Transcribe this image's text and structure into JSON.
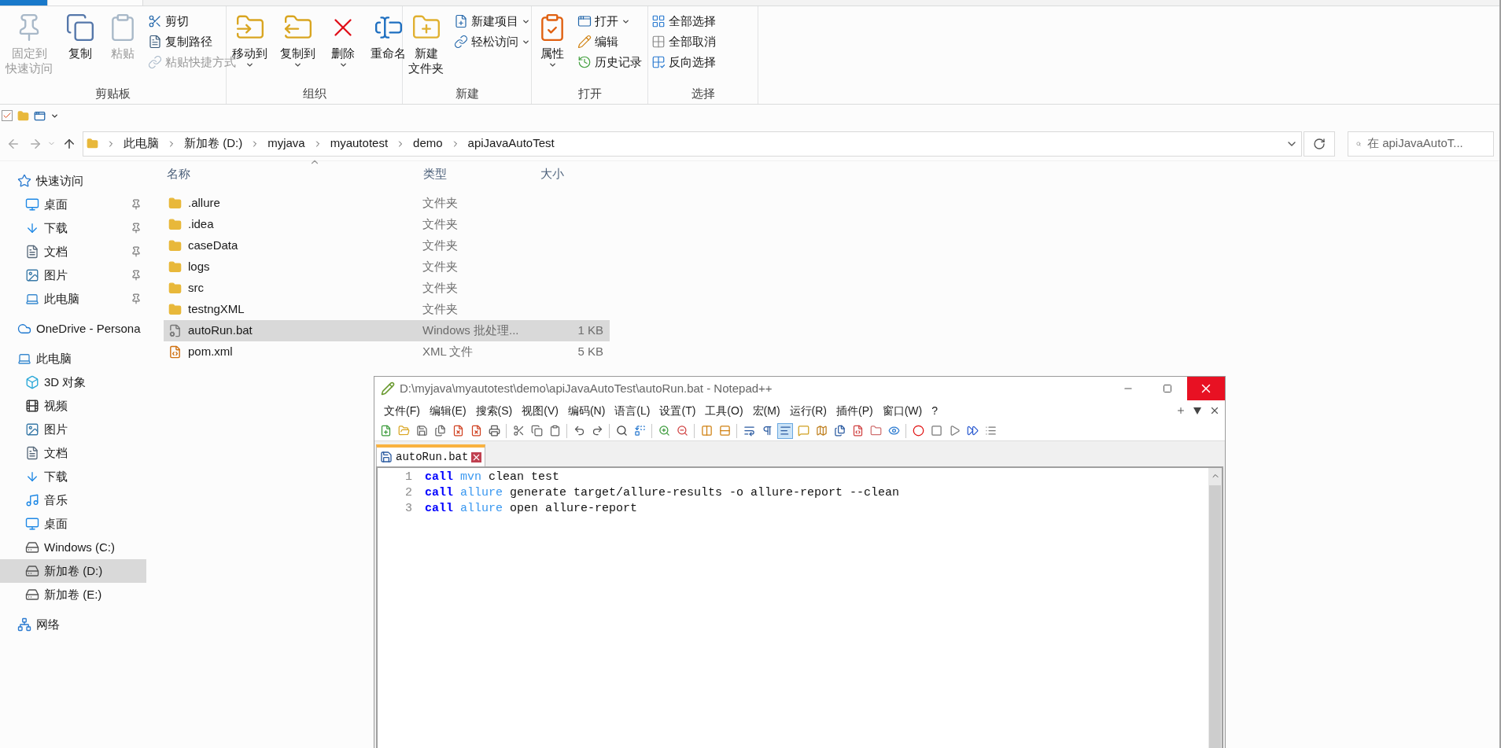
{
  "ribbon": {
    "groups": [
      {
        "label": "剪贴板",
        "items": [
          {
            "kind": "large",
            "label_lines": [
              "固定到",
              "快速访问"
            ],
            "disabled": true,
            "dropdown": false
          },
          {
            "kind": "large",
            "label": "复制",
            "disabled": false,
            "dropdown": false
          },
          {
            "kind": "large",
            "label": "粘贴",
            "disabled": true,
            "dropdown": false
          },
          {
            "kind": "small",
            "label": "剪切",
            "disabled": false,
            "dropdown": false
          },
          {
            "kind": "small",
            "label": "复制路径",
            "disabled": false,
            "dropdown": false
          },
          {
            "kind": "small",
            "label": "粘贴快捷方式",
            "disabled": true,
            "dropdown": false
          }
        ]
      },
      {
        "label": "组织",
        "items": [
          {
            "kind": "large",
            "label": "移动到",
            "disabled": false,
            "dropdown": true
          },
          {
            "kind": "large",
            "label": "复制到",
            "disabled": false,
            "dropdown": true
          },
          {
            "kind": "large",
            "label": "删除",
            "disabled": false,
            "dropdown": true
          },
          {
            "kind": "large",
            "label": "重命名",
            "disabled": false,
            "dropdown": false
          }
        ]
      },
      {
        "label": "新建",
        "items": [
          {
            "kind": "large",
            "label_lines": [
              "新建",
              "文件夹"
            ],
            "disabled": false,
            "dropdown": false
          },
          {
            "kind": "small",
            "label": "新建项目",
            "disabled": false,
            "dropdown": true
          },
          {
            "kind": "small",
            "label": "轻松访问",
            "disabled": false,
            "dropdown": true
          }
        ]
      },
      {
        "label": "打开",
        "items": [
          {
            "kind": "large",
            "label": "属性",
            "disabled": false,
            "dropdown": true
          },
          {
            "kind": "small",
            "label": "打开",
            "disabled": false,
            "dropdown": true
          },
          {
            "kind": "small",
            "label": "编辑",
            "disabled": false,
            "dropdown": false
          },
          {
            "kind": "small",
            "label": "历史记录",
            "disabled": false,
            "dropdown": false
          }
        ]
      },
      {
        "label": "选择",
        "items": [
          {
            "kind": "small",
            "label": "全部选择",
            "disabled": false,
            "dropdown": false
          },
          {
            "kind": "small",
            "label": "全部取消",
            "disabled": false,
            "dropdown": false
          },
          {
            "kind": "small",
            "label": "反向选择",
            "disabled": false,
            "dropdown": false
          }
        ]
      }
    ]
  },
  "address": {
    "breadcrumbs": [
      "此电脑",
      "新加卷 (D:)",
      "myjava",
      "myautotest",
      "demo",
      "apiJavaAutoTest"
    ],
    "search_placeholder": "在 apiJavaAutoT..."
  },
  "sidebar": {
    "items": [
      {
        "label": "快速访问",
        "kind": "star",
        "selected": false,
        "children": [
          {
            "label": "桌面",
            "kind": "desktop",
            "pinned": true,
            "selected": false
          },
          {
            "label": "下载",
            "kind": "download",
            "pinned": true,
            "selected": false
          },
          {
            "label": "文档",
            "kind": "document",
            "pinned": true,
            "selected": false
          },
          {
            "label": "图片",
            "kind": "picture",
            "pinned": true,
            "selected": false
          },
          {
            "label": "此电脑",
            "kind": "computer",
            "pinned": true,
            "selected": false
          }
        ]
      },
      {
        "label": "OneDrive - Persona",
        "kind": "cloud",
        "selected": false
      },
      {
        "label": "此电脑",
        "kind": "computer",
        "selected": false,
        "children": [
          {
            "label": "3D 对象",
            "kind": "cube",
            "selected": false
          },
          {
            "label": "视频",
            "kind": "video",
            "selected": false
          },
          {
            "label": "图片",
            "kind": "picture",
            "selected": false
          },
          {
            "label": "文档",
            "kind": "document",
            "selected": false
          },
          {
            "label": "下载",
            "kind": "download",
            "selected": false
          },
          {
            "label": "音乐",
            "kind": "music",
            "selected": false
          },
          {
            "label": "桌面",
            "kind": "desktop",
            "selected": false
          },
          {
            "label": "Windows (C:)",
            "kind": "drive",
            "selected": false
          },
          {
            "label": "新加卷 (D:)",
            "kind": "drive",
            "selected": true
          },
          {
            "label": "新加卷 (E:)",
            "kind": "drive",
            "selected": false
          }
        ]
      },
      {
        "label": "网络",
        "kind": "network",
        "selected": false
      }
    ]
  },
  "files": {
    "columns": [
      "名称",
      "类型",
      "大小"
    ],
    "rows": [
      {
        "name": ".allure",
        "type": "文件夹",
        "size": "",
        "kind": "folder",
        "selected": false
      },
      {
        "name": ".idea",
        "type": "文件夹",
        "kind": "folder",
        "selected": false
      },
      {
        "name": "caseData",
        "type": "文件夹",
        "kind": "folder",
        "selected": false
      },
      {
        "name": "logs",
        "type": "文件夹",
        "kind": "folder",
        "selected": false
      },
      {
        "name": "src",
        "type": "文件夹",
        "kind": "folder",
        "selected": false
      },
      {
        "name": "testngXML",
        "type": "文件夹",
        "kind": "folder",
        "selected": false
      },
      {
        "name": "autoRun.bat",
        "type": "Windows 批处理...",
        "size": "1 KB",
        "kind": "batch",
        "selected": true
      },
      {
        "name": "pom.xml",
        "type": "XML 文件",
        "size": "5 KB",
        "kind": "xml",
        "selected": false
      }
    ]
  },
  "notepad": {
    "title": "D:\\myjava\\myautotest\\demo\\apiJavaAutoTest\\autoRun.bat - Notepad++",
    "menu": [
      "文件(F)",
      "编辑(E)",
      "搜索(S)",
      "视图(V)",
      "编码(N)",
      "语言(L)",
      "设置(T)",
      "工具(O)",
      "宏(M)",
      "运行(R)",
      "插件(P)",
      "窗口(W)",
      "?"
    ],
    "tabs": [
      {
        "label": "autoRun.bat",
        "selected": true
      }
    ],
    "lines": [
      {
        "number": "1",
        "tokens": [
          {
            "kind": "keyword",
            "text": "call"
          },
          {
            "kind": "command",
            "text": " mvn"
          },
          {
            "kind": "plain",
            "text": " clean test"
          }
        ]
      },
      {
        "number": "2",
        "tokens": [
          {
            "kind": "keyword",
            "text": "call"
          },
          {
            "kind": "command",
            "text": " allure"
          },
          {
            "kind": "plain",
            "text": " generate target/allure-results -o allure-report --clean"
          }
        ]
      },
      {
        "number": "3",
        "tokens": [
          {
            "kind": "keyword",
            "text": "call"
          },
          {
            "kind": "command",
            "text": " allure"
          },
          {
            "kind": "plain",
            "text": " open allure-report"
          }
        ]
      }
    ]
  }
}
